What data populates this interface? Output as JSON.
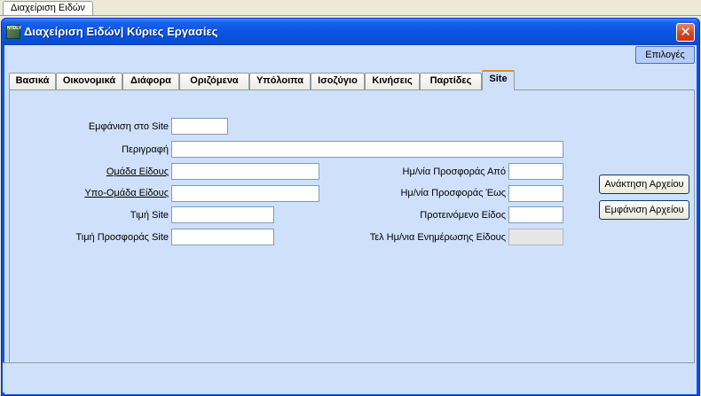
{
  "outer_tab": {
    "label": "Διαχείριση Ειδών"
  },
  "window": {
    "title": "Διαχείριση Ειδών| Κύριες Εργασίες",
    "icon_text": "NTDLY",
    "close_glyph": "✕"
  },
  "toolbar": {
    "options_label": "Επιλογές"
  },
  "tabs": [
    {
      "label": "Βασικά",
      "active": false
    },
    {
      "label": "Οικονομικά",
      "active": false
    },
    {
      "label": "Διάφορα",
      "active": false
    },
    {
      "label": "Οριζόμενα",
      "active": false
    },
    {
      "label": "Υπόλοιπα",
      "active": false
    },
    {
      "label": "Ισοζύγιο",
      "active": false
    },
    {
      "label": "Κινήσεις",
      "active": false
    },
    {
      "label": "Παρτίδες",
      "active": false
    },
    {
      "label": "Site",
      "active": true
    }
  ],
  "form": {
    "show_on_site": {
      "label": "Εμφάνιση στο Site",
      "value": ""
    },
    "description": {
      "label": "Περιγραφή",
      "value": ""
    },
    "item_group": {
      "label": "Ομάδα Είδους",
      "value": ""
    },
    "item_subgroup": {
      "label": "Υπο-Ομάδα Είδους",
      "value": ""
    },
    "site_price": {
      "label": "Τιμή Site",
      "value": ""
    },
    "site_offer_price": {
      "label": "Τιμή Προσφοράς Site",
      "value": ""
    },
    "offer_date_from": {
      "label": "Ημ/νία Προσφοράς Από",
      "value": ""
    },
    "offer_date_to": {
      "label": "Ημ/νία Προσφοράς Έως",
      "value": ""
    },
    "suggested_item": {
      "label": "Προτεινόμενο Είδος",
      "value": ""
    },
    "last_update_date": {
      "label": "Τελ Ημ/νια Ενημέρωσης Είδους",
      "value": ""
    }
  },
  "side_buttons": {
    "fetch_file": "Ανάκτηση Αρχείου",
    "show_file": "Εμφάνιση Αρχείου"
  },
  "colors": {
    "titlebar": "#0a52e0",
    "client_bg": "#cfe0fb",
    "active_tab_accent": "#e68b2c",
    "close_button": "#d3431d"
  }
}
